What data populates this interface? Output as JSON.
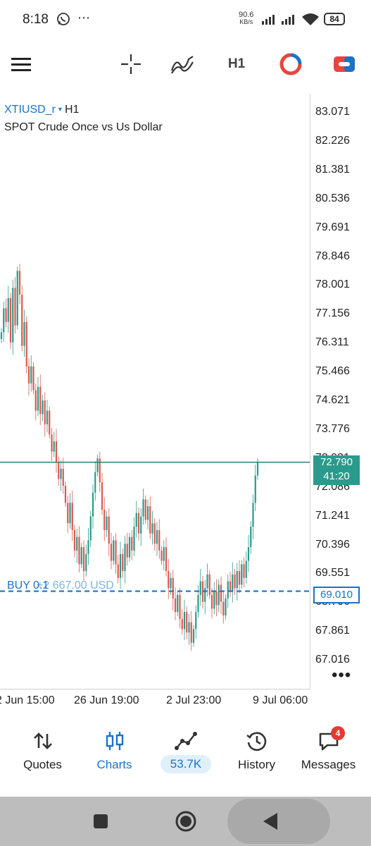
{
  "status_bar": {
    "time": "8:18",
    "net_speed_value": "90.6",
    "net_speed_unit": "KB/s",
    "battery": "84",
    "icons": [
      "whatsapp-icon",
      "more-dots-icon",
      "signal-icon",
      "signal-icon",
      "wifi-icon",
      "battery-icon"
    ]
  },
  "toolbar": {
    "menu_icon": "hamburger-menu-icon",
    "crosshair_icon": "crosshair-icon",
    "indicators_icon": "indicators-icon",
    "timeframe": "H1",
    "objects_icon": "chart-objects-icon",
    "trade_icon": "trade-toggle-icon",
    "accent_red": "#e8453c",
    "accent_blue": "#1a73c8"
  },
  "chart": {
    "symbol": "XTIUSD_r",
    "symbol_arrow": "▾",
    "timeframe": "H1",
    "description": "SPOT Crude Once vs Us Dollar",
    "price_axis_labels": [
      "83.071",
      "82.226",
      "81.381",
      "80.536",
      "79.691",
      "78.846",
      "78.001",
      "77.156",
      "76.311",
      "75.466",
      "74.621",
      "73.776",
      "72.931",
      "72.086",
      "71.241",
      "70.396",
      "69.551",
      "68.706",
      "67.861",
      "67.016"
    ],
    "time_axis_labels": [
      "2 Jun 15:00",
      "26 Jun 19:00",
      "2 Jul 23:00",
      "9 Jul 06:00"
    ],
    "current_price": "72.790",
    "countdown": "41:20",
    "buy_line_price": "69.010",
    "buy_label": "BUY 0.1",
    "buy_label_overlay": "+2 667.00 USD",
    "more_icon": "more-dots-icon",
    "colors": {
      "bull": "#2a9a8c",
      "bear": "#e0574f",
      "current_line": "#2a7f74",
      "buy_line": "#1a73c8"
    }
  },
  "bottom_nav": {
    "items": [
      {
        "label": "Quotes",
        "icon": "quotes-arrows-icon"
      },
      {
        "label": "Charts",
        "icon": "candlestick-chart-icon"
      },
      {
        "label": "53.7K",
        "icon": "trade-line-icon"
      },
      {
        "label": "History",
        "icon": "history-clock-icon"
      },
      {
        "label": "Messages",
        "icon": "messages-icon"
      }
    ],
    "messages_badge": "4",
    "active_color": "#1a73c8"
  },
  "system_nav": {
    "icons": [
      "recent-apps-icon",
      "home-icon",
      "back-icon"
    ]
  }
}
